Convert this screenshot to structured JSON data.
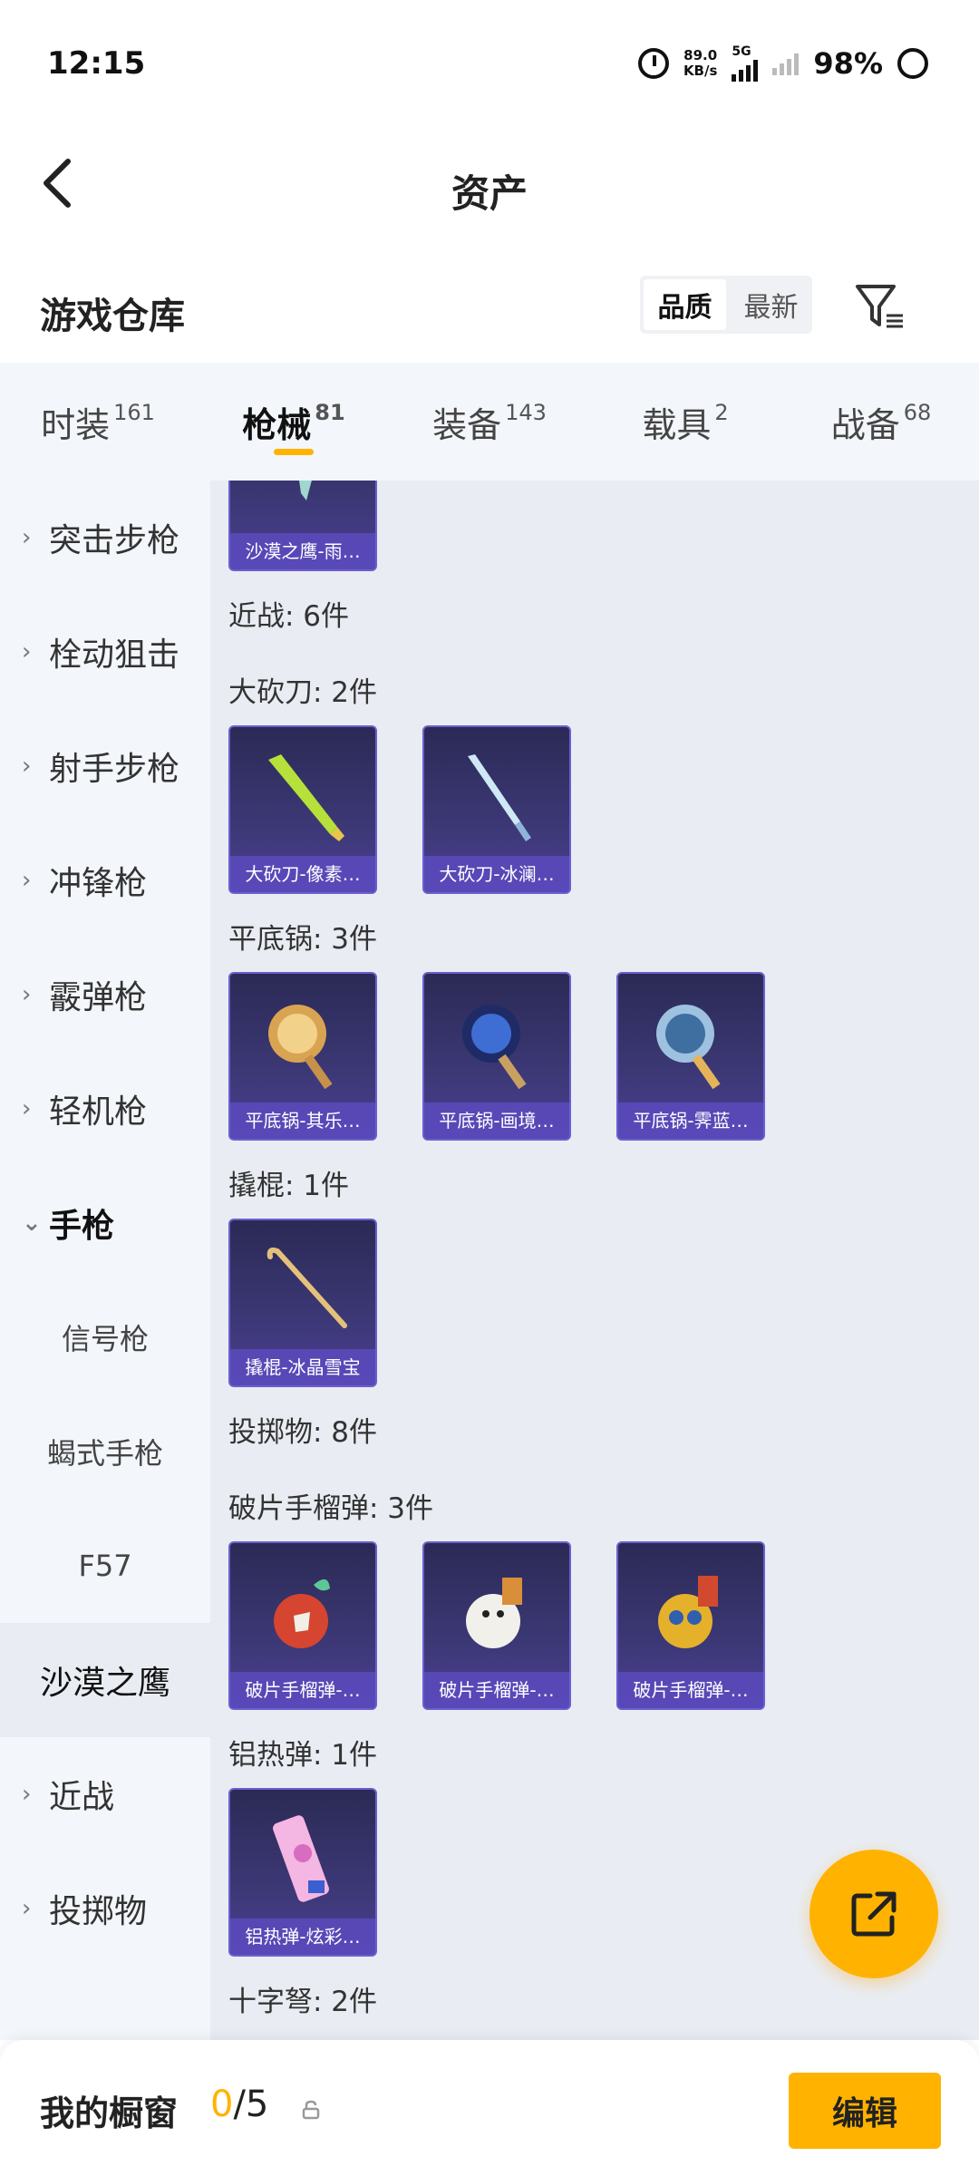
{
  "status_bar": {
    "time": "12:15",
    "net_speed_value": "89.0",
    "net_speed_unit": "KB/s",
    "signal_label": "5G",
    "battery": "98%"
  },
  "header": {
    "title": "资产"
  },
  "section": {
    "title": "游戏仓库",
    "sort_options": [
      "品质",
      "最新"
    ]
  },
  "tabs": [
    {
      "label": "时装",
      "count": "161"
    },
    {
      "label": "枪械",
      "count": "81"
    },
    {
      "label": "装备",
      "count": "143"
    },
    {
      "label": "载具",
      "count": "2"
    },
    {
      "label": "战备",
      "count": "68"
    }
  ],
  "sidebar": {
    "items": [
      "突击步枪",
      "栓动狙击",
      "射手步枪",
      "冲锋枪",
      "霰弹枪",
      "轻机枪",
      "手枪"
    ],
    "subitems": [
      "信号枪",
      "蝎式手枪",
      "F57",
      "沙漠之鹰"
    ],
    "after": [
      "近战",
      "投掷物"
    ]
  },
  "content": {
    "top_card": "沙漠之鹰-雨…",
    "groups": [
      {
        "label": "近战: 6件"
      },
      {
        "label": "大砍刀: 2件",
        "items": [
          "大砍刀-像素…",
          "大砍刀-冰澜…"
        ]
      },
      {
        "label": "平底锅: 3件",
        "items": [
          "平底锅-其乐…",
          "平底锅-画境…",
          "平底锅-霁蓝…"
        ]
      },
      {
        "label": "撬棍: 1件",
        "items": [
          "撬棍-冰晶雪宝"
        ]
      },
      {
        "label": "投掷物: 8件"
      },
      {
        "label": "破片手榴弹: 3件",
        "items": [
          "破片手榴弹-…",
          "破片手榴弹-…",
          "破片手榴弹-…"
        ]
      },
      {
        "label": "铝热弹: 1件",
        "items": [
          "铝热弹-炫彩…"
        ]
      },
      {
        "label": "十字弩: 2件"
      }
    ]
  },
  "bottom": {
    "label": "我的橱窗",
    "count_current": "0",
    "count_total": "/5",
    "edit": "编辑"
  },
  "colors": {
    "accent": "#ffb300",
    "card_bg": "#3c3876",
    "caption_bg": "#5c4abe"
  }
}
